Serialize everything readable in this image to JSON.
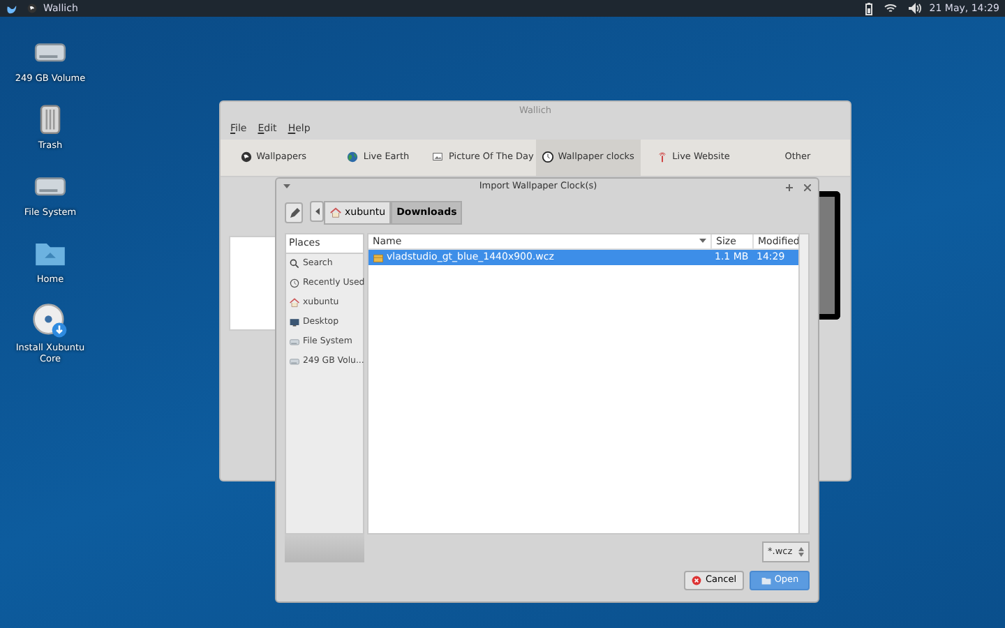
{
  "top_panel": {
    "app_title": "Wallich",
    "clock": "21 May, 14:29"
  },
  "desktop_icons": [
    {
      "label": "249 GB Volume",
      "kind": "drive"
    },
    {
      "label": "Trash",
      "kind": "trash"
    },
    {
      "label": "File System",
      "kind": "drive"
    },
    {
      "label": "Home",
      "kind": "folder"
    },
    {
      "label": "Install Xubuntu Core",
      "kind": "disc"
    }
  ],
  "main_window": {
    "title": "Wallich",
    "menu": [
      "File",
      "Edit",
      "Help"
    ],
    "tabs": [
      {
        "label": "Wallpapers",
        "kind": "wallpapers",
        "selected": false
      },
      {
        "label": "Live Earth",
        "kind": "earth",
        "selected": false
      },
      {
        "label": "Picture Of The Day",
        "kind": "picture",
        "selected": false
      },
      {
        "label": "Wallpaper clocks",
        "kind": "clock",
        "selected": true
      },
      {
        "label": "Live Website",
        "kind": "antenna",
        "selected": false
      },
      {
        "label": "Other",
        "kind": "none",
        "selected": false
      }
    ]
  },
  "dialog": {
    "title": "Import Wallpaper Clock(s)",
    "path": [
      {
        "label": "xubuntu",
        "kind": "home",
        "selected": false
      },
      {
        "label": "Downloads",
        "kind": "none",
        "selected": true
      }
    ],
    "places_header": "Places",
    "places": [
      {
        "label": "Search",
        "kind": "search"
      },
      {
        "label": "Recently Used",
        "kind": "recent"
      },
      {
        "label": "xubuntu",
        "kind": "home"
      },
      {
        "label": "Desktop",
        "kind": "desktop"
      },
      {
        "label": "File System",
        "kind": "drive"
      },
      {
        "label": "249 GB Volu...",
        "kind": "drive"
      }
    ],
    "columns": [
      "Name",
      "Size",
      "Modified"
    ],
    "files": [
      {
        "name": "vladstudio_gt_blue_1440x900.wcz",
        "size": "1.1 MB",
        "modified": "14:29",
        "selected": true
      }
    ],
    "filter": "*.wcz",
    "buttons": [
      {
        "label": "Cancel",
        "kind": "cancel"
      },
      {
        "label": "Open",
        "kind": "open"
      }
    ]
  }
}
